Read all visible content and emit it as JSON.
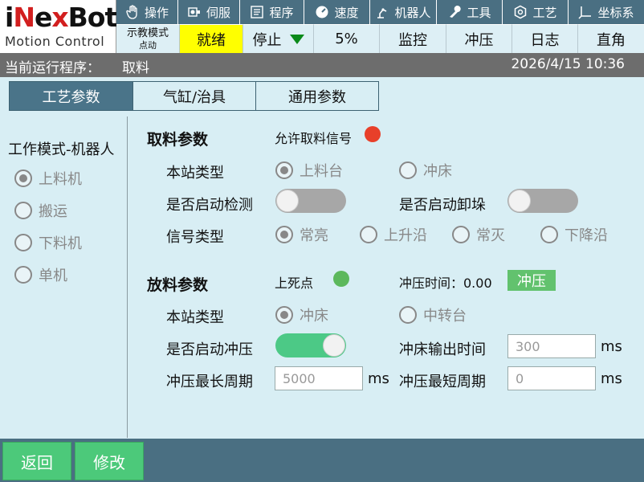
{
  "logo": {
    "brand_prefix": "i",
    "brand_x": "N",
    "brand_mid": "e",
    "brand_x2": "x",
    "brand_rest": "Bot",
    "tagline": "Motion Control"
  },
  "menu": [
    {
      "label": "操作",
      "icon": "hand-icon"
    },
    {
      "label": "伺服",
      "icon": "servo-icon"
    },
    {
      "label": "程序",
      "icon": "program-icon"
    },
    {
      "label": "速度",
      "icon": "speed-gauge-icon"
    },
    {
      "label": "机器人",
      "icon": "robot-arm-icon"
    },
    {
      "label": "工具",
      "icon": "wrench-icon"
    },
    {
      "label": "工艺",
      "icon": "process-icon"
    },
    {
      "label": "坐标系",
      "icon": "axis-icon"
    }
  ],
  "status": {
    "mode_line1": "示教模式",
    "mode_line2": "点动",
    "ready": "就绪",
    "run_state": "停止",
    "speed": "5%",
    "monitor": "监控",
    "punch": "冲压",
    "log": "日志",
    "coord": "直角"
  },
  "program_bar": {
    "label": "当前运行程序：",
    "program": "取料",
    "datetime": "2026/4/15 10:36"
  },
  "tabs": [
    {
      "label": "工艺参数",
      "active": true
    },
    {
      "label": "气缸/治具",
      "active": false
    },
    {
      "label": "通用参数",
      "active": false
    }
  ],
  "work_mode": {
    "title": "工作模式-机器人",
    "options": [
      "上料机",
      "搬运",
      "下料机",
      "单机"
    ],
    "selected": 0
  },
  "pick": {
    "title": "取料参数",
    "allow_signal_label": "允许取料信号",
    "allow_signal_color": "#e8402a",
    "station_type_label": "本站类型",
    "station_options": [
      "上料台",
      "冲床"
    ],
    "station_selected": 0,
    "detect_label": "是否启动检测",
    "detect_on": false,
    "unstack_label": "是否启动卸垛",
    "unstack_on": false,
    "signal_type_label": "信号类型",
    "signal_options": [
      "常亮",
      "上升沿",
      "常灭",
      "下降沿"
    ],
    "signal_selected": 0
  },
  "place": {
    "title": "放料参数",
    "top_dead_label": "上死点",
    "top_dead_color": "#5cb85c",
    "punch_time_label": "冲压时间：0.00",
    "punch_button": "冲压",
    "station_type_label": "本站类型",
    "station_options": [
      "冲床",
      "中转台"
    ],
    "station_selected": 0,
    "press_label": "是否启动冲压",
    "press_on": true,
    "press_out_label": "冲床输出时间",
    "press_out_value": "300",
    "max_cycle_label": "冲压最长周期",
    "max_cycle_value": "5000",
    "min_cycle_label": "冲压最短周期",
    "min_cycle_value": "0",
    "unit": "ms"
  },
  "bottom": {
    "back": "返回",
    "edit": "修改"
  }
}
